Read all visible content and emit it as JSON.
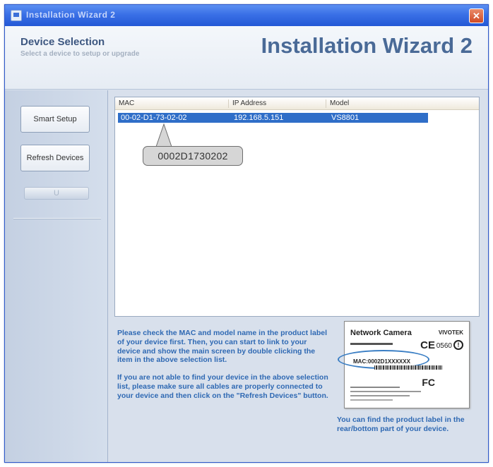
{
  "window": {
    "title": "Installation Wizard 2",
    "close_glyph": "✕"
  },
  "header": {
    "section_title": "Device Selection",
    "section_subtitle": "Select a device to setup or upgrade",
    "app_title": "Installation Wizard 2"
  },
  "sidebar": {
    "smart_setup_label": "Smart Setup",
    "refresh_devices_label": "Refresh Devices",
    "disabled_button_label": "U"
  },
  "device_list": {
    "columns": [
      "MAC",
      "IP Address",
      "Model"
    ],
    "rows": [
      {
        "mac": "00-02-D1-73-02-02",
        "ip": "192.168.5.151",
        "model": "VS8801"
      }
    ],
    "callout": "0002D1730202"
  },
  "instructions": {
    "para1": "Please check the MAC and model name in the product label of your device first. Then, you can start to link to your device and show the main screen by double clicking the item in the above selection list.",
    "para2": "If you are not able to find your device in the above selection list, please make sure all cables are properly connected to your device and then click on the \"Refresh Devices\" button."
  },
  "product_label": {
    "title": "Network Camera",
    "brand": "VIVOTEK",
    "ce_mark": "CE",
    "ce_number": "0560",
    "info_mark": "!",
    "mac_text": "MAC:0002D1XXXXXX",
    "fc_mark": "FC",
    "caption": "You can find the product label in the rear/bottom part of your device."
  },
  "colors": {
    "titlebar": "#3a70e6",
    "selection": "#2f6ec8",
    "instruction_text": "#2f69b3",
    "header_title": "#4a6a97"
  }
}
